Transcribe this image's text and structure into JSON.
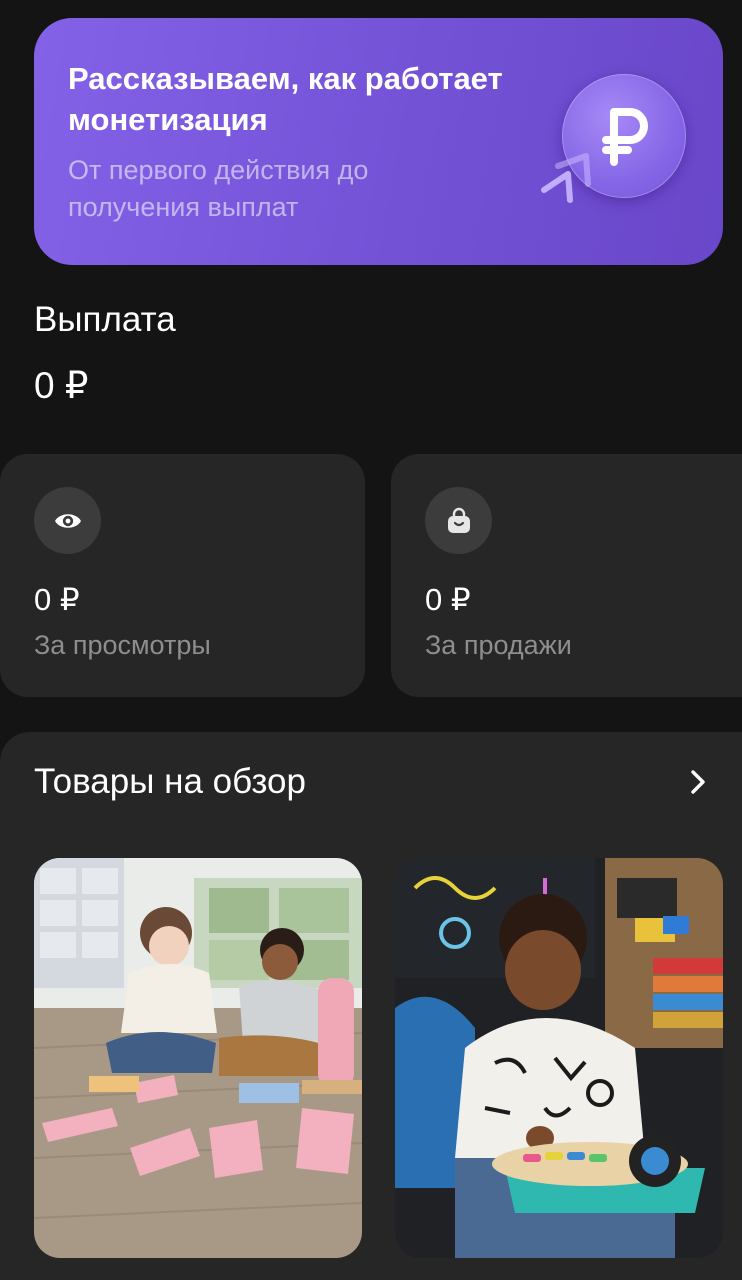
{
  "promo": {
    "title": "Рассказываем, как работает монетизация",
    "subtitle": "От первого действия до получения выплат",
    "icon": "ruble-coin-icon",
    "bg_color": "#7352d6"
  },
  "payout": {
    "title": "Выплата",
    "value": "0 ₽"
  },
  "stats": [
    {
      "icon": "eye-icon",
      "value": "0 ₽",
      "label": "За просмотры"
    },
    {
      "icon": "shopping-bag-icon",
      "value": "0 ₽",
      "label": "За продажи"
    }
  ],
  "products_section": {
    "title": "Товары на обзор",
    "chevron_icon": "chevron-right-icon",
    "items": [
      {
        "image": "children-playing-body-puzzle-photo"
      },
      {
        "image": "toddler-playing-musical-toy-photo"
      }
    ]
  }
}
